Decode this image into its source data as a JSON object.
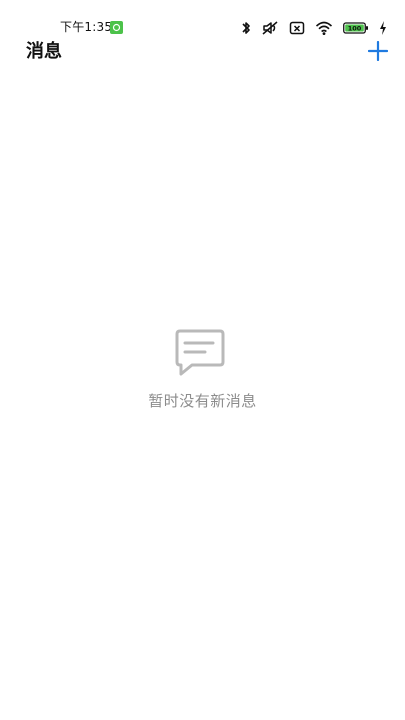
{
  "status_bar": {
    "time": "下午1:35",
    "battery_level": "100",
    "icons": [
      "bluetooth-icon",
      "mute-icon",
      "no-sim-icon",
      "wifi-icon",
      "battery-icon",
      "charging-icon"
    ]
  },
  "header": {
    "title": "消息",
    "add_icon": "plus-icon"
  },
  "empty_state": {
    "icon": "message-icon",
    "text": "暂时没有新消息"
  },
  "colors": {
    "accent": "#1f7ae0",
    "empty_icon": "#b9b9b9",
    "empty_text": "#8c8c8c",
    "battery_fill": "#4cc24a"
  }
}
